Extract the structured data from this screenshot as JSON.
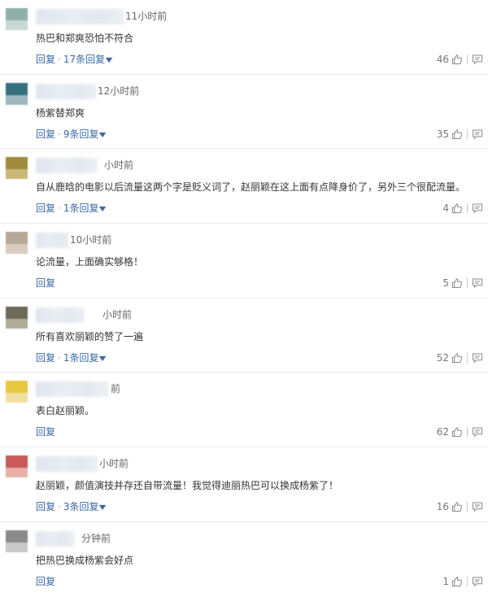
{
  "comments": [
    {
      "time": "11小时前",
      "text": "热巴和郑爽恐怕不符合",
      "reply_label": "回复",
      "replies_label": "17条回复",
      "likes": "46",
      "avatar": {
        "top": "#8fb0a8",
        "bottom": "#c8d8d4"
      }
    },
    {
      "time": "12小时前",
      "text": "杨紫替郑爽",
      "reply_label": "回复",
      "replies_label": "9条回复",
      "likes": "35",
      "avatar": {
        "top": "#35707f",
        "bottom": "#9db8c0"
      }
    },
    {
      "time": "小时前",
      "text": "自从鹿晗的电影以后流量这两个字是贬义词了，赵丽颖在这上面有点降身价了，另外三个很配流量。",
      "reply_label": "回复",
      "replies_label": "1条回复",
      "likes": "4",
      "avatar": {
        "top": "#a08a3c",
        "bottom": "#c9b878"
      }
    },
    {
      "time": "10小时前",
      "text": "论流量，上面确实够格！",
      "reply_label": "回复",
      "replies_label": "",
      "likes": "5",
      "avatar": {
        "top": "#b8a898",
        "bottom": "#d8ccc0"
      }
    },
    {
      "time": "小时前",
      "text": "所有喜欢丽颖的赞了一遍",
      "reply_label": "回复",
      "replies_label": "1条回复",
      "likes": "52",
      "avatar": {
        "top": "#6e6a5a",
        "bottom": "#b0ac98"
      }
    },
    {
      "time": "前",
      "text": "表白赵丽颖。",
      "reply_label": "回复",
      "replies_label": "",
      "likes": "62",
      "avatar": {
        "top": "#e8c840",
        "bottom": "#f0e0a0"
      }
    },
    {
      "time": "小时前",
      "text": "赵丽颖，颜值演技并存还自带流量！我觉得迪丽热巴可以换成杨紫了！",
      "reply_label": "回复",
      "replies_label": "3条回复",
      "likes": "16",
      "avatar": {
        "top": "#c85a5a",
        "bottom": "#e8b0a8"
      }
    },
    {
      "time": "分钟前",
      "text": "把热巴换成杨紫会好点",
      "reply_label": "回复",
      "replies_label": "",
      "likes": "1",
      "avatar": {
        "top": "#8a8a8a",
        "bottom": "#c8c8c8"
      }
    }
  ],
  "colors": {
    "link": "#3a6aa6",
    "text": "#333333",
    "meta": "#777777"
  }
}
